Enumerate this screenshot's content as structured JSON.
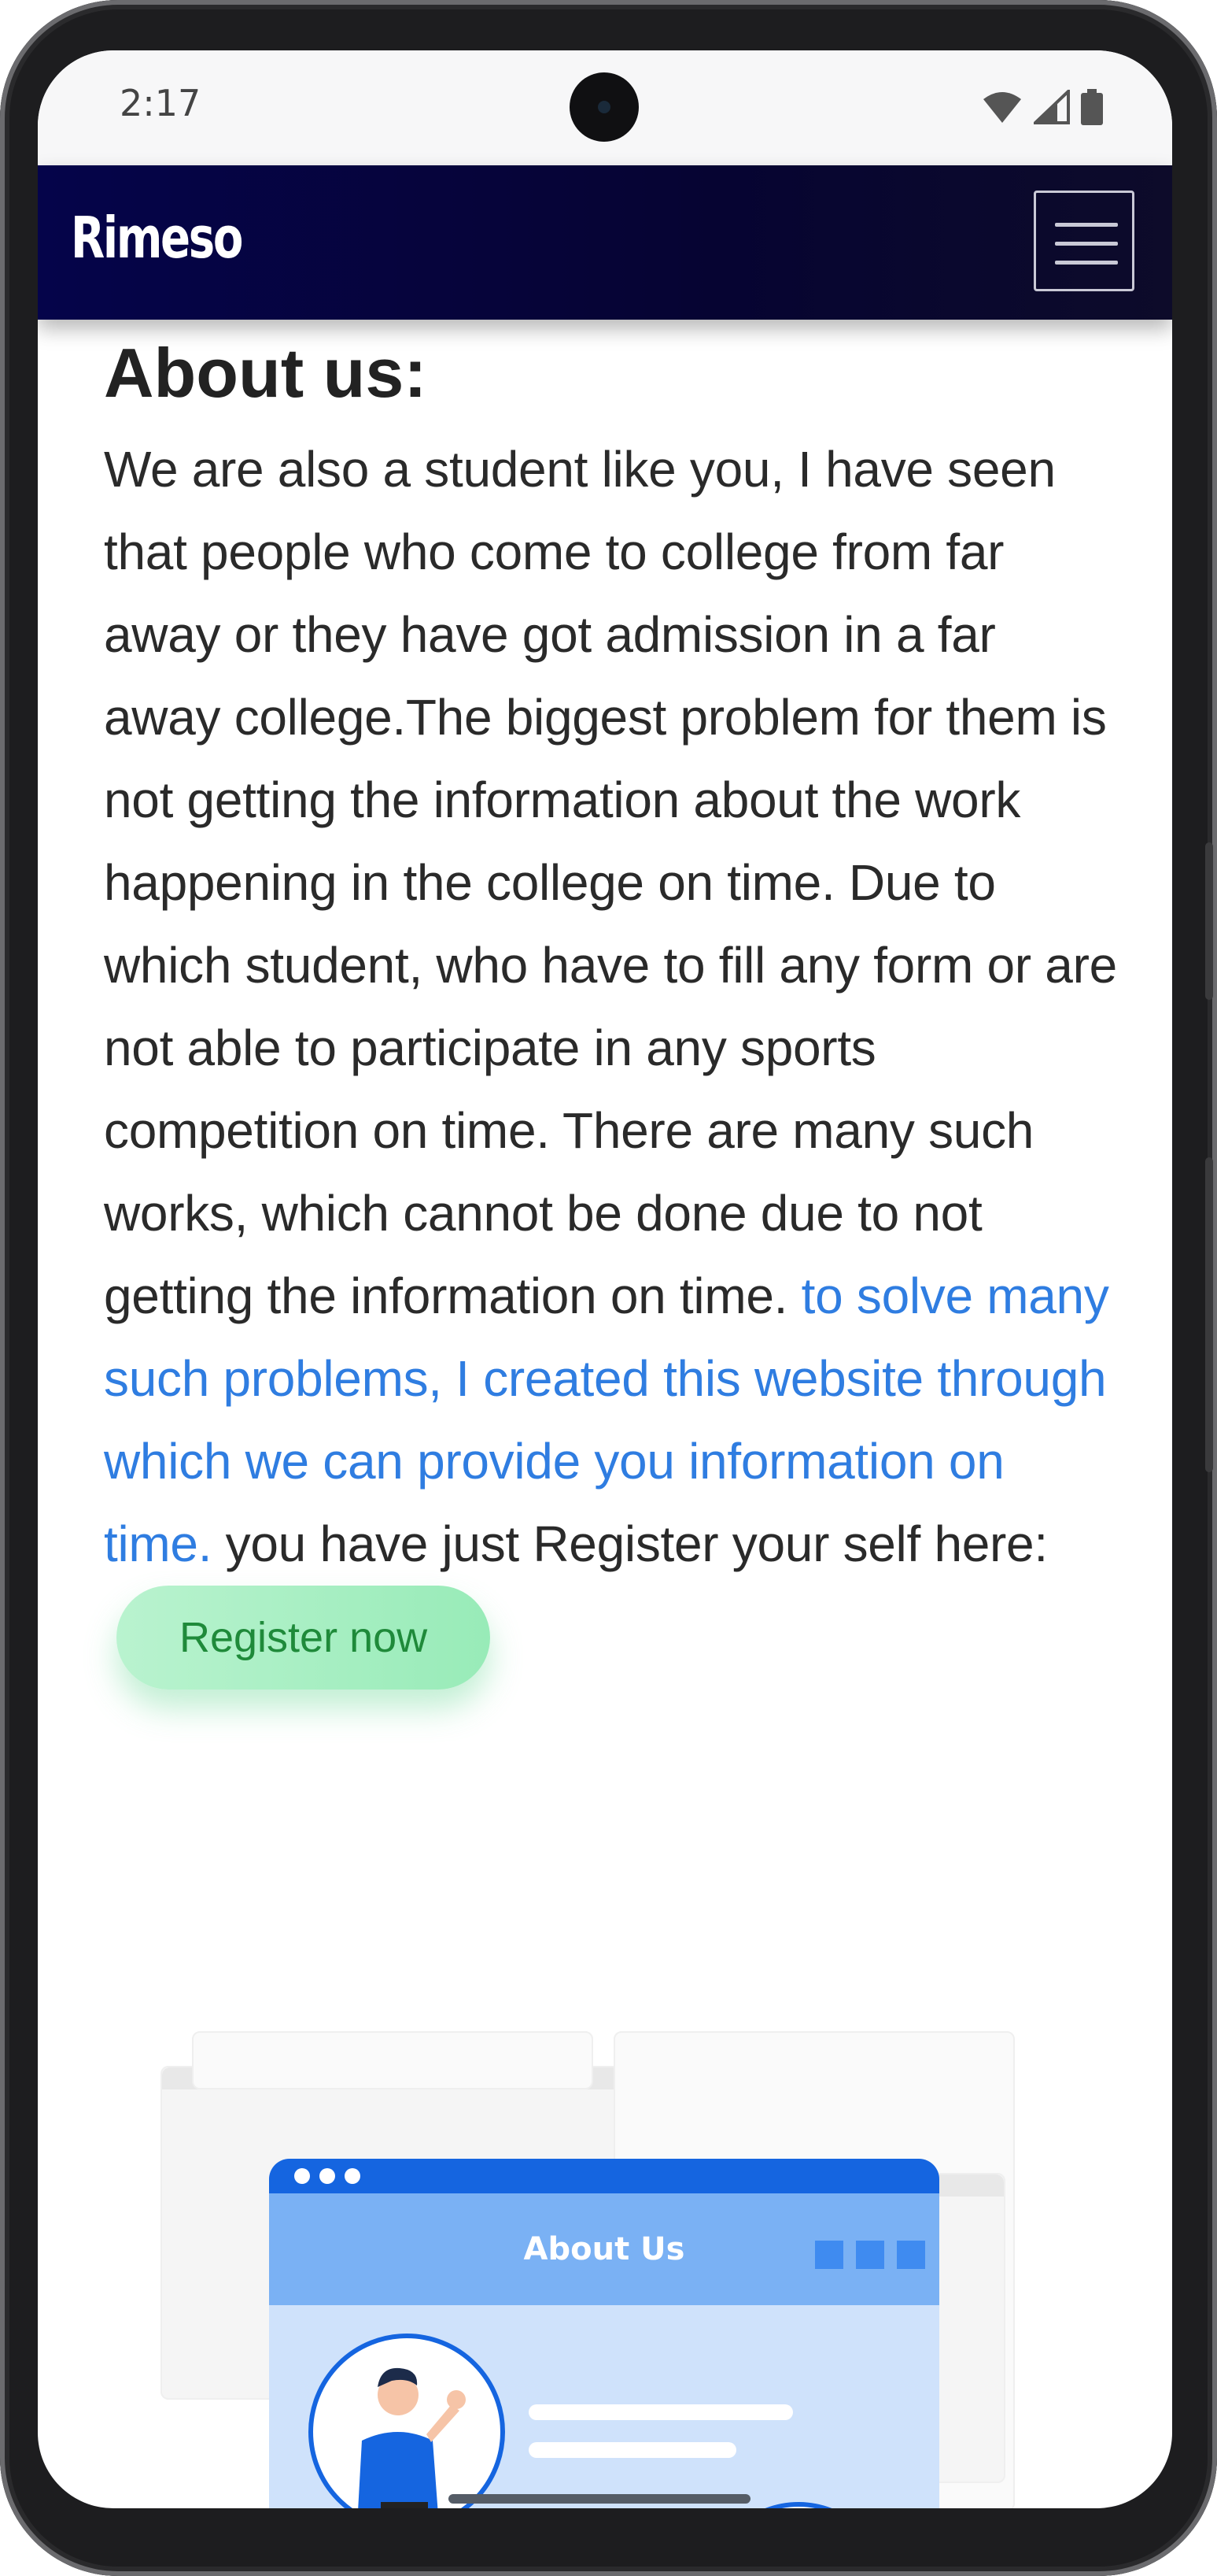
{
  "status_bar": {
    "time": "2:17"
  },
  "navbar": {
    "brand": "Rimeso"
  },
  "about": {
    "heading": "About us:",
    "paragraph_main": "We are also a student like you, I have seen that people who come to college from far away or they have got admission in a far away college.The biggest problem for them is not getting the information about the work happening in the college on time. Due to which student, who have to fill any form or are not able to participate in any sports competition on time. There are many such works, which cannot be done due to not getting the information on time. ",
    "paragraph_highlight": "to solve many such problems, I created this website through which we can provide you information on time.",
    "paragraph_end": " you have just Register your self here:",
    "register_button": "Register now"
  },
  "illustration": {
    "title": "About Us"
  },
  "colors": {
    "navbar_bg": "#05044a",
    "highlight_link": "#2f7de1",
    "register_button_bg": "#a9f0c4",
    "register_button_text": "#1f8a3a",
    "illustration_blue": "#1565e0"
  }
}
